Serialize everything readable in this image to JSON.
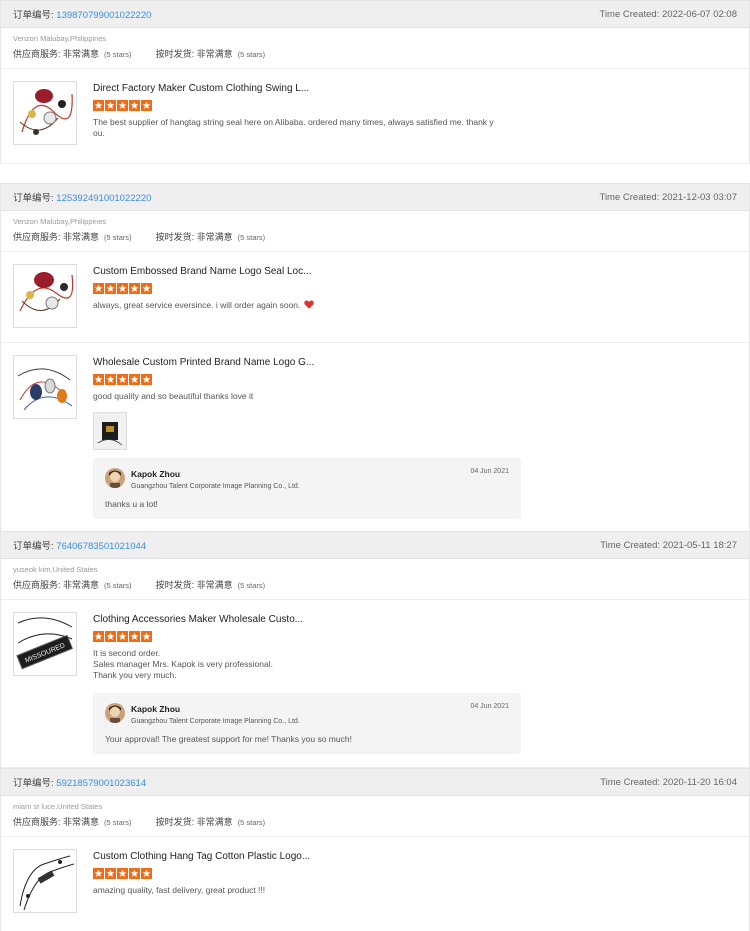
{
  "labels": {
    "order_no": "订单编号:",
    "time_created": "Time Created:",
    "supplier_service": "供应商服务:",
    "delivery_on_time": "按时发货:",
    "very_satisfied": "非常满意",
    "five_stars": "(5 stars)"
  },
  "colors": {
    "star": "#f36b12",
    "link": "#3b8ee0",
    "header_bg": "#efefef",
    "heart": "#e0302e"
  },
  "icons": {
    "star": "star-icon",
    "heart": "heart-icon",
    "avatar": "avatar-icon"
  },
  "orders": [
    {
      "order_no": "139870799001022220",
      "time": "2022-06-07 02:08",
      "buyer": "Venzon Malubay,Philippines",
      "products": [
        {
          "title": "Direct Factory Maker Custom Clothing Swing L...",
          "rating": 5,
          "comment": "The best supplier of hangtag string seal here on Alibaba. ordered many times, always satisfied me. thank y ou."
        }
      ]
    },
    {
      "order_no": "125392491001022220",
      "time": "2021-12-03 03:07",
      "buyer": "Venzon Malubay,Philippines",
      "products": [
        {
          "title": "Custom Embossed Brand Name Logo Seal Loc...",
          "rating": 5,
          "comment": "always, great service eversince. i will order again soon."
        },
        {
          "title": "Wholesale Custom Printed Brand Name Logo G...",
          "rating": 5,
          "comment": "good quality and so beautiful thanks love it",
          "reply": {
            "name": "Kapok Zhou",
            "company": "Guangzhou Talent Corporate Image Planning Co., Ltd.",
            "date": "04 Jun 2021",
            "text": "thanks u a lot!"
          }
        }
      ]
    },
    {
      "order_no": "76406783501021044",
      "time": "2021-05-11 18:27",
      "buyer": "yuseok kim,United States",
      "products": [
        {
          "title": "Clothing Accessories Maker Wholesale Custo...",
          "rating": 5,
          "comment": "It is second order.\nSales manager Mrs. Kapok is very professional.\nThank you very much.",
          "thumb_text": "MISSOURED",
          "reply": {
            "name": "Kapok Zhou",
            "company": "Guangzhou Talent Corporate Image Planning Co., Ltd.",
            "date": "04 Jun 2021",
            "text": "Your approval! The greatest support for me! Thanks  you so much!"
          }
        }
      ]
    },
    {
      "order_no": "59218579001023614",
      "time": "2020-11-20 16:04",
      "buyer": "miam st luce,United States",
      "products": [
        {
          "title": "Custom Clothing Hang Tag Cotton Plastic Logo...",
          "rating": 5,
          "comment": "amazing quality, fast delivery, great product !!!"
        }
      ]
    }
  ]
}
